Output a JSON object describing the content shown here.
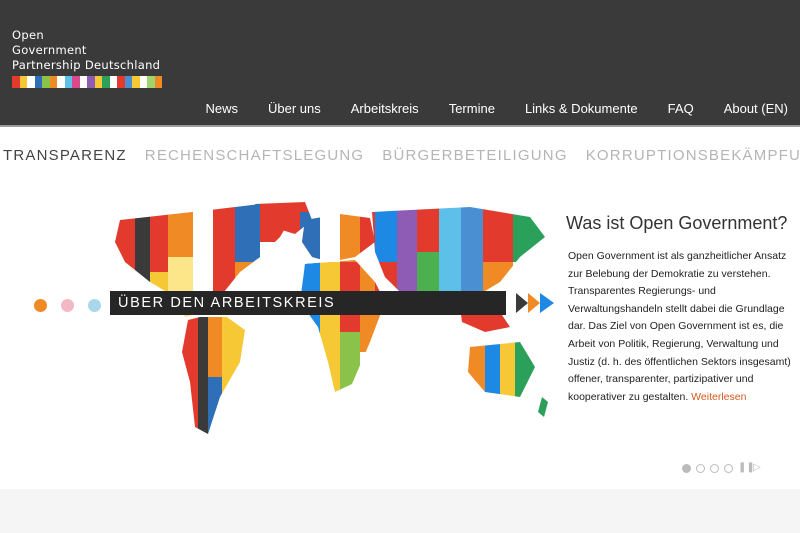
{
  "logo": {
    "lines": [
      "Open",
      "Government",
      "Partnership Deutschland"
    ],
    "stripe_colors": [
      "#e23b2e",
      "#f7c836",
      "#ffffff",
      "#2f6fb7",
      "#8bc34a",
      "#f08a24",
      "#ffffff",
      "#5cc0e8",
      "#d94a8c",
      "#ffffff",
      "#8e5bb5",
      "#f7c836",
      "#2aa05a",
      "#ffffff",
      "#e23b2e",
      "#4a8fd1",
      "#f7c836",
      "#ffffff",
      "#9fd46e",
      "#f08a24"
    ]
  },
  "nav": {
    "items": [
      "News",
      "Über uns",
      "Arbeitskreis",
      "Termine",
      "Links & Dokumente",
      "FAQ",
      "About (EN)"
    ]
  },
  "keywords": {
    "items": [
      "TRANSPARENZ",
      "RECHENSCHAFTSLEGUNG",
      "BÜRGERBETEILIGUNG",
      "KORRUPTIONSBEKÄMPFUNG"
    ],
    "active_index": 0
  },
  "slider": {
    "banner_label": "ÜBER DEN ARBEITSKREIS",
    "dot_colors": [
      "#f08a24",
      "#f2b8c6",
      "#a8d8ea"
    ],
    "arrow_colors": [
      "#3a3a3a",
      "#f08a24",
      "#1e88e5"
    ]
  },
  "panel": {
    "title": "Was ist Open Government?",
    "body": "Open Government ist als ganzheitlicher Ansatz zur Belebung der Demokratie zu verstehen. Transparentes Regierungs- und Verwaltungshandeln stellt dabei die Grundlage dar. Das Ziel von Open Government ist es, die Arbeit von Politik, Regierung, Verwaltung und Justiz (d. h. des öffentlichen Sektors insgesamt) offener, transparenter, partizipativer und kooperativer zu gestalten.",
    "read_more": "Weiterlesen"
  },
  "pager": {
    "count": 4,
    "active_index": 0
  },
  "colors": {
    "header_bg": "#3a3a3a",
    "accent_orange": "#d35a1e",
    "keyword_inactive": "#b5b5b5",
    "keyword_active": "#444444"
  }
}
